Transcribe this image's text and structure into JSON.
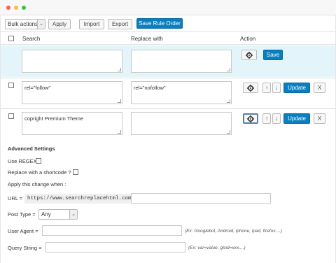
{
  "toolbar": {
    "bulk_select": "Bulk actions",
    "apply": "Apply",
    "import": "Import",
    "export": "Export",
    "save_order": "Save Rule Order"
  },
  "table": {
    "col_search": "Search",
    "col_replace": "Replace with",
    "col_action": "Action",
    "new_row": {
      "save_label": "Save"
    },
    "rows": [
      {
        "search": "rel=\"follow\"",
        "replace": "rel=\"nofollow\"",
        "update_label": "Update",
        "delete_label": "X",
        "up": "↑",
        "down": "↓"
      },
      {
        "search": "copright Premium Theme",
        "replace": "",
        "update_label": "Update",
        "delete_label": "X",
        "up": "↑",
        "down": "↓"
      }
    ]
  },
  "advanced": {
    "title": "Advanced Settings",
    "use_regex": "Use REGEX",
    "replace_shortcode": "Replace with a shortcode ?",
    "apply_when": "Apply this change when :",
    "url_label": "URL =",
    "url_value": "https://www.searchreplacehtml.com",
    "post_type_label": "Post Type =",
    "post_type_value": "Any",
    "user_agent_label": "User Agent =",
    "user_agent_hint": "(Ex: Googlebot, Android, iphone, ipad, firefox....)",
    "query_label": "Query String =",
    "query_hint": "(Ex: var=value, glcid=xxx....)"
  },
  "colors": {
    "primary": "#0a7fc0",
    "new_row_bg": "#e3f5fb"
  }
}
